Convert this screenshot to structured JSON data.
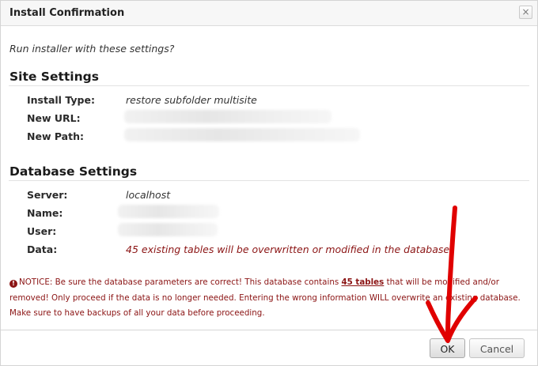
{
  "dialog": {
    "title": "Install Confirmation",
    "close_glyph": "×",
    "prompt": "Run installer with these settings?"
  },
  "site_settings": {
    "heading": "Site Settings",
    "rows": [
      {
        "label": "Install Type:",
        "value": "restore subfolder multisite"
      },
      {
        "label": "New URL:",
        "value": ""
      },
      {
        "label": "New Path:",
        "value": ""
      }
    ]
  },
  "database_settings": {
    "heading": "Database Settings",
    "rows": [
      {
        "label": "Server:",
        "value": "localhost"
      },
      {
        "label": "Name:",
        "value": ""
      },
      {
        "label": "User:",
        "value": ""
      },
      {
        "label": "Data:",
        "value": "45 existing tables will be overwritten or modified in the database"
      }
    ]
  },
  "notice": {
    "icon": "!",
    "text_before": "NOTICE: Be sure the database parameters are correct! This database contains ",
    "highlight": "45 tables",
    "text_after": " that will be modified and/or removed! Only proceed if the data is no longer needed. Entering the wrong information WILL overwrite an existing database. Make sure to have backups of all your data before proceeding."
  },
  "buttons": {
    "ok": "OK",
    "cancel": "Cancel"
  },
  "colors": {
    "danger": "#8b1414",
    "annotation_arrow": "#e00000"
  },
  "icons": {
    "close": "close-icon",
    "notice": "exclamation-circle-icon",
    "annotation": "hand-drawn-arrow-icon"
  }
}
